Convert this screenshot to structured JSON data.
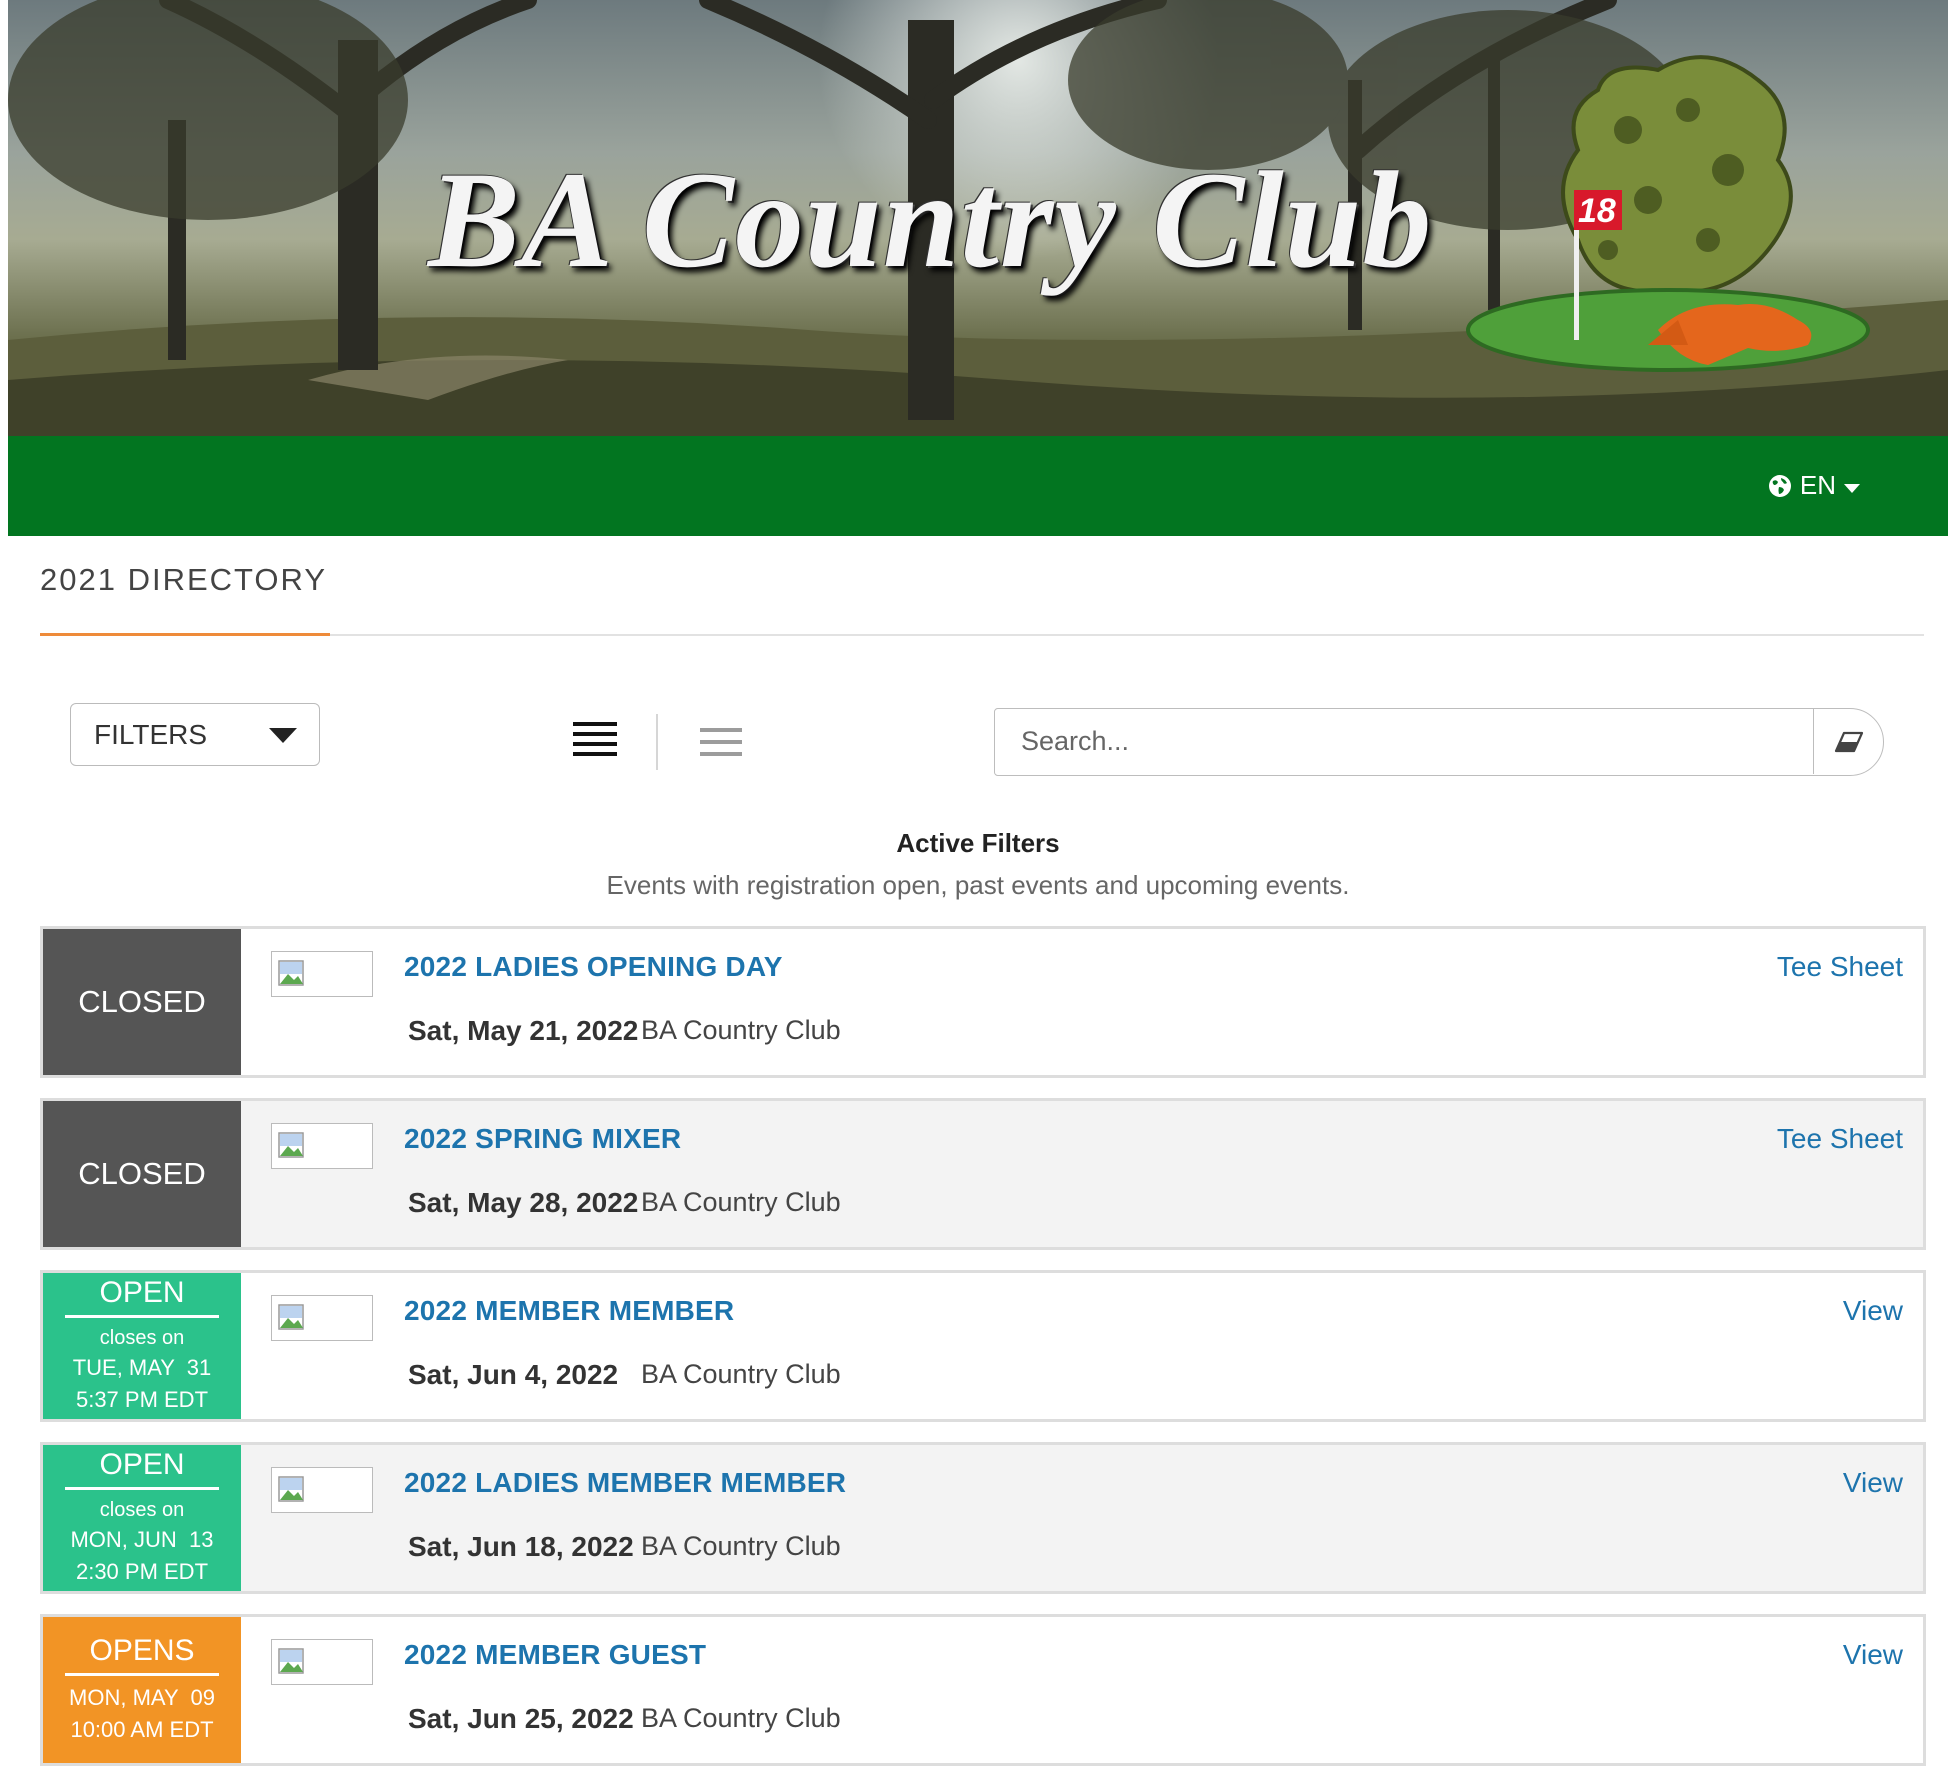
{
  "header": {
    "club_name": "BA Country Club",
    "flag_number": "18",
    "language": "EN"
  },
  "directory": {
    "title": "2021 DIRECTORY"
  },
  "toolbar": {
    "filters_label": "FILTERS",
    "search_placeholder": "Search..."
  },
  "active_filters": {
    "title": "Active Filters",
    "description": "Events with registration open, past events and upcoming events."
  },
  "events": [
    {
      "status": "CLOSED",
      "title": "2022 LADIES OPENING DAY",
      "date": "Sat, May 21, 2022",
      "location": "BA Country Club",
      "action": "Tee Sheet"
    },
    {
      "status": "CLOSED",
      "title": "2022 SPRING MIXER",
      "date": "Sat, May 28, 2022",
      "location": "BA Country Club",
      "action": "Tee Sheet"
    },
    {
      "status": "OPEN",
      "status_note": "closes on",
      "status_day": "TUE, MAY  31",
      "status_time": "5:37 PM EDT",
      "title": "2022 MEMBER MEMBER",
      "date": "Sat, Jun 4, 2022",
      "location": "BA Country Club",
      "action": "View"
    },
    {
      "status": "OPEN",
      "status_note": "closes on",
      "status_day": "MON, JUN  13",
      "status_time": "2:30 PM EDT",
      "title": "2022 LADIES MEMBER MEMBER",
      "date": "Sat, Jun 18, 2022",
      "location": "BA Country Club",
      "action": "View"
    },
    {
      "status": "OPENS",
      "status_day": "MON, MAY  09",
      "status_time": "10:00 AM EDT",
      "title": "2022 MEMBER GUEST",
      "date": "Sat, Jun 25, 2022",
      "location": "BA Country Club",
      "action": "View"
    }
  ],
  "colors": {
    "nav_green": "#027520",
    "closed": "#555555",
    "open": "#2bc28b",
    "opens": "#f29425",
    "link": "#1d74ad",
    "accent": "#ee8b3a"
  }
}
